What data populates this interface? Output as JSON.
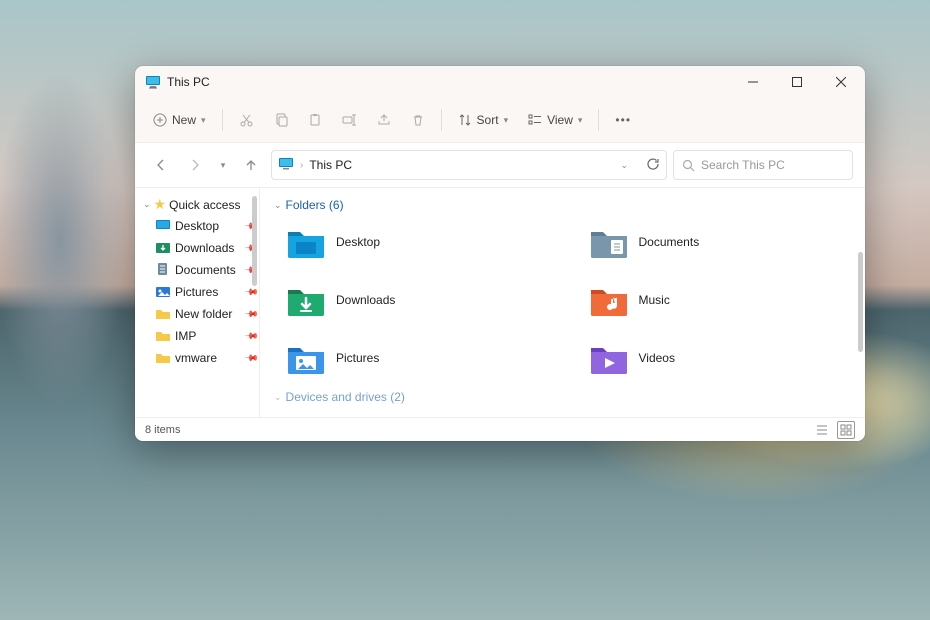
{
  "window": {
    "title": "This PC"
  },
  "toolbar": {
    "new_label": "New",
    "sort_label": "Sort",
    "view_label": "View"
  },
  "address": {
    "crumb": "This PC"
  },
  "search": {
    "placeholder": "Search This PC"
  },
  "sidebar": {
    "quick_access": "Quick access",
    "items": [
      {
        "label": "Desktop"
      },
      {
        "label": "Downloads"
      },
      {
        "label": "Documents"
      },
      {
        "label": "Pictures"
      },
      {
        "label": "New folder"
      },
      {
        "label": "IMP"
      },
      {
        "label": "vmware"
      }
    ]
  },
  "content": {
    "folders_header": "Folders (6)",
    "devices_header": "Devices and drives (2)",
    "folders": [
      {
        "label": "Desktop"
      },
      {
        "label": "Documents"
      },
      {
        "label": "Downloads"
      },
      {
        "label": "Music"
      },
      {
        "label": "Pictures"
      },
      {
        "label": "Videos"
      }
    ]
  },
  "status": {
    "items": "8 items"
  }
}
